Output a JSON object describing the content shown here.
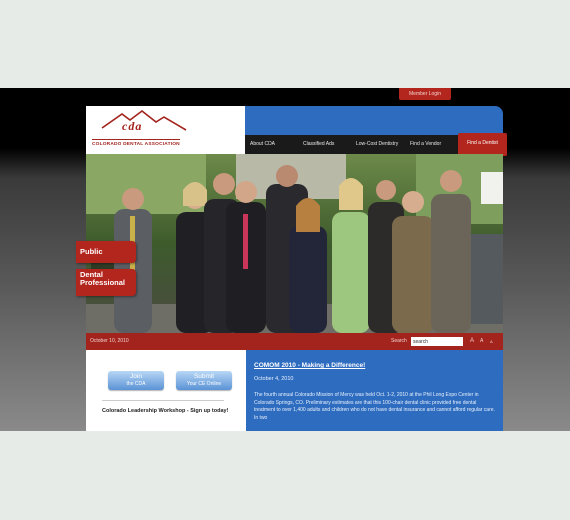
{
  "header": {
    "member_login": "Member Login",
    "logo_abbr": "cda",
    "logo_name": "COLORADO DENTAL ASSOCIATION"
  },
  "nav": {
    "items": [
      "About CDA",
      "Classified Ads",
      "Low-Cost Dentistry",
      "Find a Vendor"
    ],
    "find_dentist": "Find a Dentist"
  },
  "side_buttons": {
    "public": "Public",
    "dental_line1": "Dental",
    "dental_line2": "Professional"
  },
  "bar": {
    "date": "October 10, 2010",
    "search_label": "Search",
    "search_value": "search",
    "font_icons": [
      "A",
      "A",
      "A"
    ]
  },
  "left": {
    "join_main": "Join",
    "join_sub": "the CDA",
    "submit_main": "Submit",
    "submit_sub": "Your CE Online",
    "workshop": "Colorado Leadership Workshop - Sign up today!"
  },
  "news": {
    "title": "COMOM 2010 - Making a Difference!",
    "date": "October 4, 2010",
    "body": "The fourth annual Colorado Mission of Mercy was held Oct. 1-2, 2010 at the Phil Long Expo Center in Colorado Springs, CO. Preliminary estimates are that this 100-chair dental clinic provided free dental treatment to over 1,400 adults and children who do not have dental insurance and cannot afford regular care. In two"
  },
  "colors": {
    "brand_red": "#a3231d",
    "brand_blue": "#2e6cc0",
    "page_bg": "#e6ebe8"
  }
}
